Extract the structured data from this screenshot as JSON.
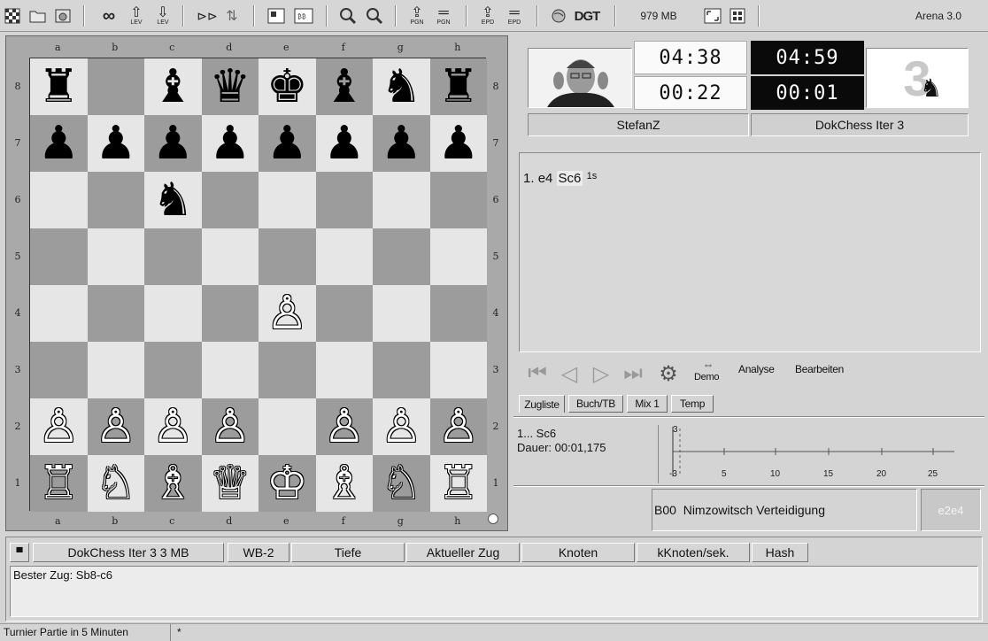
{
  "toolbar": {
    "memory": "979 MB",
    "app_title": "Arena 3.0",
    "buttons": [
      {
        "name": "new-board-icon"
      },
      {
        "name": "open-folder-icon"
      },
      {
        "name": "save-icon"
      },
      {
        "name": "infinite-analysis-icon",
        "glyph": "∞"
      },
      {
        "name": "level-up-icon",
        "sub": "LEV"
      },
      {
        "name": "level-down-icon",
        "sub": "LEV"
      },
      {
        "name": "demo-icon"
      },
      {
        "name": "flip-board-icon"
      },
      {
        "name": "board-view-icon"
      },
      {
        "name": "notation-view-icon"
      },
      {
        "name": "zoom-in-icon"
      },
      {
        "name": "zoom-out-icon"
      },
      {
        "name": "pgn-plus-icon",
        "sub": "PGN"
      },
      {
        "name": "pgn-minus-icon",
        "sub": "PGN"
      },
      {
        "name": "epd-plus-icon",
        "sub": "EPD"
      },
      {
        "name": "epd-minus-icon",
        "sub": "EPD"
      },
      {
        "name": "globe-icon"
      },
      {
        "name": "dgt-icon",
        "label": "DGT"
      },
      {
        "name": "fullscreen-icon"
      },
      {
        "name": "grid-view-icon"
      }
    ]
  },
  "board": {
    "files": [
      "a",
      "b",
      "c",
      "d",
      "e",
      "f",
      "g",
      "h"
    ],
    "ranks": [
      "8",
      "7",
      "6",
      "5",
      "4",
      "3",
      "2",
      "1"
    ],
    "squares": [
      [
        "♜",
        "",
        "♝",
        "♛",
        "♚",
        "♝",
        "♞",
        "♜"
      ],
      [
        "♟",
        "♟",
        "♟",
        "♟",
        "♟",
        "♟",
        "♟",
        "♟"
      ],
      [
        "",
        "",
        "♞",
        "",
        "",
        "",
        "",
        ""
      ],
      [
        "",
        "",
        "",
        "",
        "",
        "",
        "",
        ""
      ],
      [
        "",
        "",
        "",
        "",
        "♙",
        "",
        "",
        ""
      ],
      [
        "",
        "",
        "",
        "",
        "",
        "",
        "",
        ""
      ],
      [
        "♙",
        "♙",
        "♙",
        "♙",
        "",
        "♙",
        "♙",
        "♙"
      ],
      [
        "♖",
        "♘",
        "♗",
        "♕",
        "♔",
        "♗",
        "♘",
        "♖"
      ]
    ]
  },
  "players": {
    "white": {
      "name": "StefanZ",
      "time_total": "04:38",
      "time_move": "00:22"
    },
    "black": {
      "name": "DokChess Iter 3",
      "time_total": "04:59",
      "time_move": "00:01",
      "logo_text": "3"
    }
  },
  "moves": {
    "number": "1.",
    "white_move": "e4",
    "black_move": "Sc6",
    "black_time": "1s"
  },
  "move_controls": {
    "demo": "Demo",
    "analyse": "Analyse",
    "edit": "Bearbeiten"
  },
  "tabs": [
    "Zugliste",
    "Buch/TB",
    "Mix 1",
    "Temp"
  ],
  "eval": {
    "last_move": "1... Sc6",
    "duration": "Dauer: 00:01,175",
    "y_top": "3",
    "y_bottom": "-3",
    "x_ticks": [
      "5",
      "10",
      "15",
      "20",
      "25"
    ]
  },
  "opening": {
    "code": "B00",
    "name": "Nimzowitsch Verteidigung",
    "last_move_box": "e2e4"
  },
  "engine": {
    "columns": [
      "DokChess Iter 3  3 MB",
      "WB-2",
      "Tiefe",
      "Aktueller Zug",
      "Knoten",
      "kKnoten/sek.",
      "Hash"
    ],
    "best_move": "Bester Zug: Sb8-c6"
  },
  "status": {
    "game_type": "Turnier Partie in 5 Minuten",
    "flag": "*"
  }
}
